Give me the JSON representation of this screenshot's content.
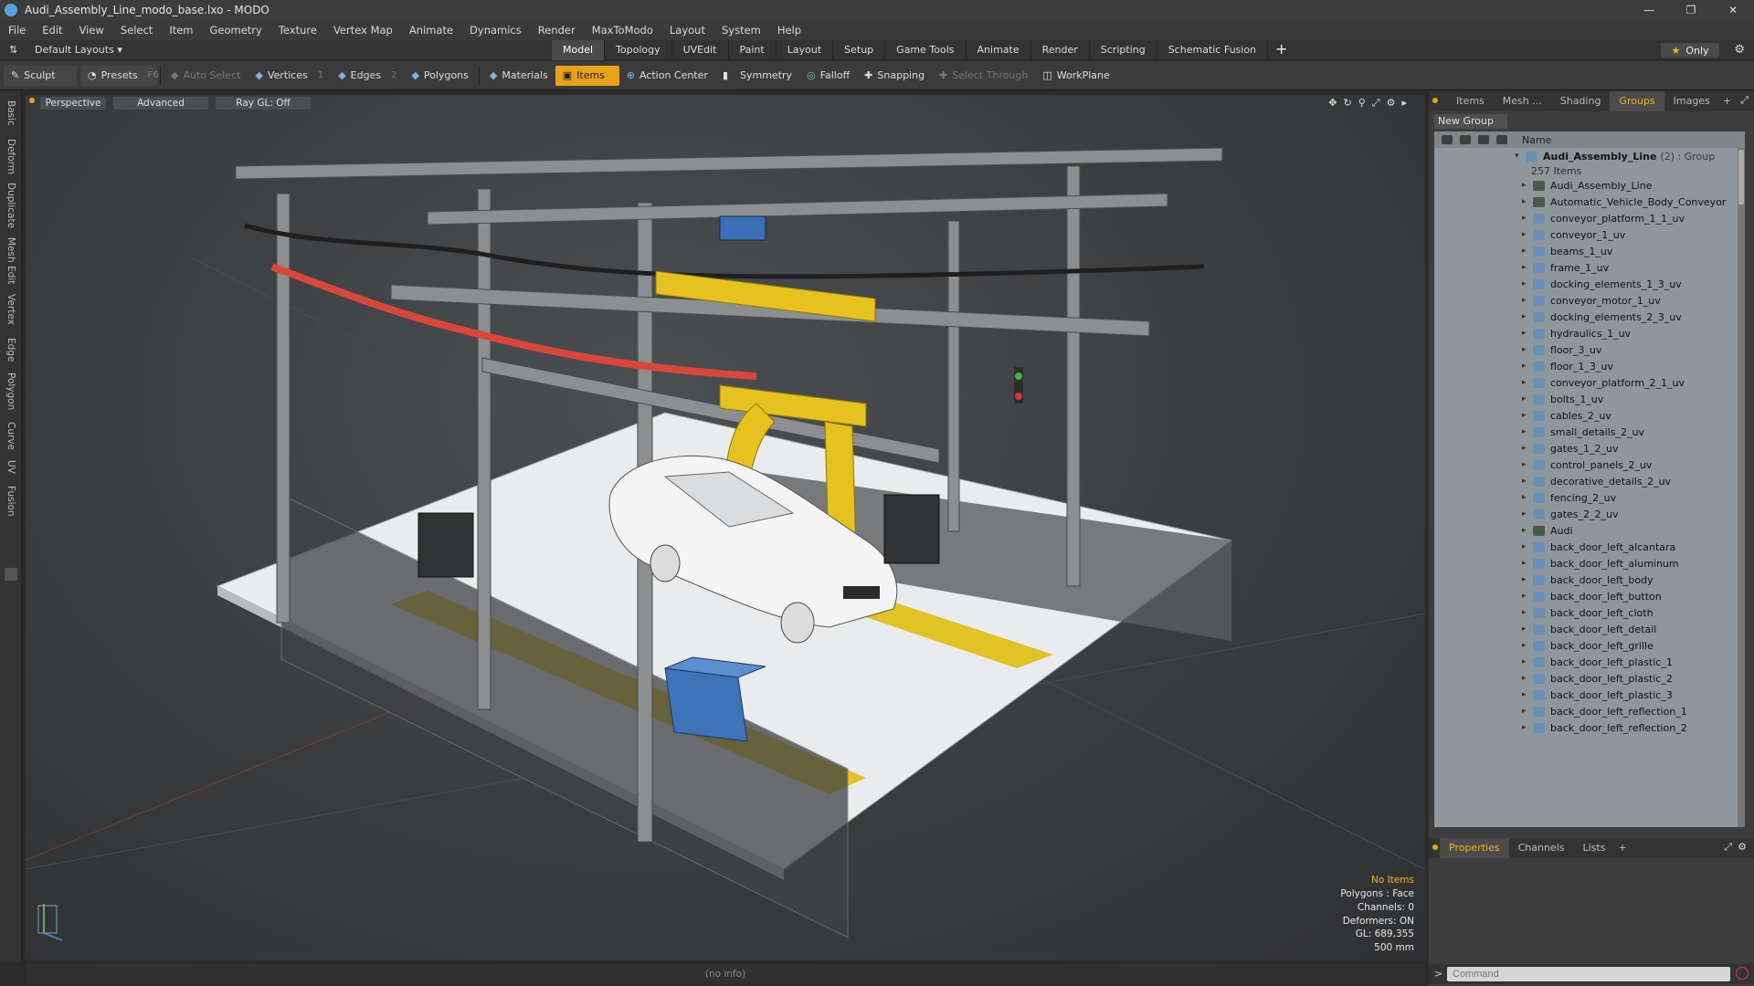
{
  "window": {
    "title": "Audi_Assembly_Line_modo_base.lxo - MODO"
  },
  "menu": [
    "File",
    "Edit",
    "View",
    "Select",
    "Item",
    "Geometry",
    "Texture",
    "Vertex Map",
    "Animate",
    "Dynamics",
    "Render",
    "MaxToModo",
    "Layout",
    "System",
    "Help"
  ],
  "layoutbar": {
    "layouts_label": "Default Layouts",
    "tabs": [
      "Model",
      "Topology",
      "UVEdit",
      "Paint",
      "Layout",
      "Setup",
      "Game Tools",
      "Animate",
      "Render",
      "Scripting",
      "Schematic Fusion"
    ],
    "active_tab": "Model",
    "only_label": "Only"
  },
  "toolbar": {
    "sculpt": "Sculpt",
    "presets": "Presets",
    "presets_key": "F6",
    "auto_select": "Auto Select",
    "vertices": "Vertices",
    "vertices_key": "1",
    "edges": "Edges",
    "edges_key": "2",
    "polygons": "Polygons",
    "materials": "Materials",
    "items": "Items",
    "action_center": "Action Center",
    "symmetry": "Symmetry",
    "falloff": "Falloff",
    "snapping": "Snapping",
    "select_through": "Select Through",
    "workplane": "WorkPlane"
  },
  "left_tabs": [
    "Basic",
    "Deform",
    "Duplicate",
    "Mesh Edit",
    "Vertex",
    "Edge",
    "Polygon",
    "Curve",
    "UV",
    "Fusion"
  ],
  "viewport": {
    "view_label": "Perspective",
    "shading_label": "Advanced",
    "raygl_label": "Ray GL: Off",
    "info": {
      "selection": "No Items",
      "polygons": "Polygons : Face",
      "channels": "Channels: 0",
      "deformers": "Deformers: ON",
      "gl": "GL: 689,355",
      "scale": "500 mm"
    }
  },
  "status": "(no info)",
  "panel": {
    "tabs": [
      "Items",
      "Mesh ...",
      "Shading",
      "Groups",
      "Images"
    ],
    "active_tab": "Groups",
    "new_group": "New Group",
    "column_name": "Name",
    "group_name": "Audi_Assembly_Line",
    "group_count": "(2) : Group",
    "group_items": "257 Items",
    "rows": [
      "Audi_Assembly_Line",
      "Automatic_Vehicle_Body_Conveyor",
      "conveyor_platform_1_1_uv",
      "conveyor_1_uv",
      "beams_1_uv",
      "frame_1_uv",
      "docking_elements_1_3_uv",
      "conveyor_motor_1_uv",
      "docking_elements_2_3_uv",
      "hydraulics_1_uv",
      "floor_3_uv",
      "floor_1_3_uv",
      "conveyor_platform_2_1_uv",
      "bolts_1_uv",
      "cables_2_uv",
      "small_details_2_uv",
      "gates_1_2_uv",
      "control_panels_2_uv",
      "decorative_details_2_uv",
      "fencing_2_uv",
      "gates_2_2_uv",
      "Audi",
      "back_door_left_alcantara",
      "back_door_left_aluminum",
      "back_door_left_body",
      "back_door_left_button",
      "back_door_left_cloth",
      "back_door_left_detail",
      "back_door_left_grille",
      "back_door_left_plastic_1",
      "back_door_left_plastic_2",
      "back_door_left_plastic_3",
      "back_door_left_reflection_1",
      "back_door_left_reflection_2"
    ],
    "bottom_tabs": [
      "Properties",
      "Channels",
      "Lists"
    ],
    "bottom_active": "Properties",
    "command_placeholder": "Command"
  },
  "colors": {
    "accent": "#e8a21a",
    "viewport_bg": "#3d3f41",
    "list_bg": "#8f979c"
  }
}
